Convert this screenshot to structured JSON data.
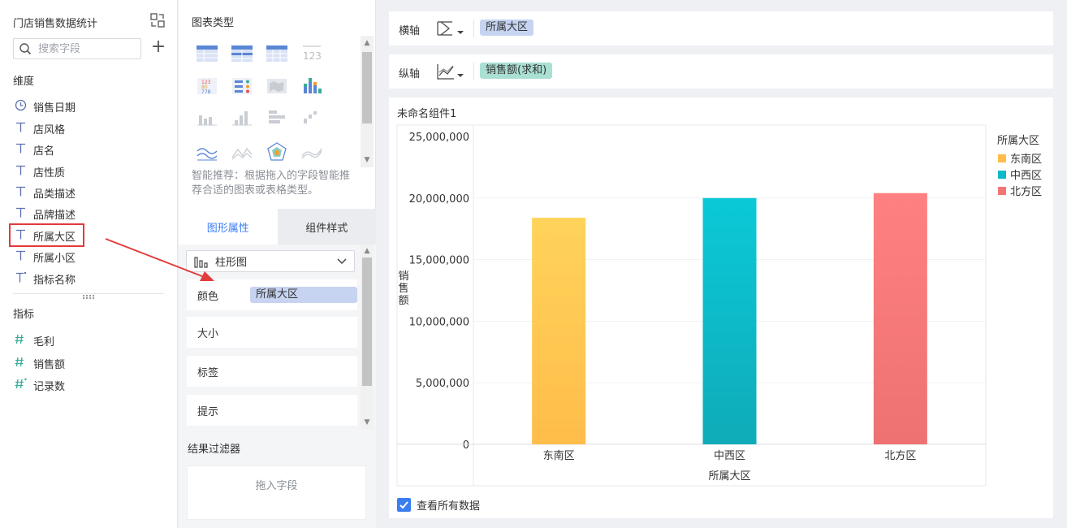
{
  "left": {
    "title": "门店销售数据统计",
    "search_placeholder": "搜索字段",
    "dimension_label": "维度",
    "dimensions": [
      {
        "label": "销售日期",
        "icon": "clock-icon"
      },
      {
        "label": "店风格",
        "icon": "text-type-icon"
      },
      {
        "label": "店名",
        "icon": "text-type-icon"
      },
      {
        "label": "店性质",
        "icon": "text-type-icon"
      },
      {
        "label": "品类描述",
        "icon": "text-type-icon"
      },
      {
        "label": "品牌描述",
        "icon": "text-type-icon"
      },
      {
        "label": "所属大区",
        "icon": "text-type-icon"
      },
      {
        "label": "所属小区",
        "icon": "text-type-icon"
      },
      {
        "label": "指标名称",
        "icon": "text-calc-icon"
      }
    ],
    "measure_label": "指标",
    "measures": [
      {
        "label": "毛利",
        "icon": "number-icon"
      },
      {
        "label": "销售额",
        "icon": "number-icon"
      },
      {
        "label": "记录数",
        "icon": "number-calc-icon"
      }
    ]
  },
  "mid": {
    "chart_type_title": "图表类型",
    "hint": "智能推荐：根据拖入的字段智能推荐合适的图表或表格类型。",
    "tabs": [
      {
        "label": "图形属性"
      },
      {
        "label": "组件样式"
      }
    ],
    "chart_type_selected": "柱形图",
    "props": {
      "color_label": "颜色",
      "color_field": "所属大区",
      "size_label": "大小",
      "label_label": "标签",
      "tooltip_label": "提示"
    },
    "filter_title": "结果过滤器",
    "filter_drop": "拖入字段"
  },
  "right": {
    "x_axis_label": "横轴",
    "x_axis_field": "所属大区",
    "y_axis_label": "纵轴",
    "y_axis_field": "销售额(求和)",
    "view_all": "查看所有数据"
  },
  "colors": {
    "accent": "#3c7df0",
    "bar1_top": "#ffd35a",
    "bar1_bottom": "#ffbd4a",
    "bar2_top": "#0bc9d8",
    "bar2_bottom": "#0fabb8",
    "bar3_top": "#ff8080",
    "bar3_bottom": "#ee7272"
  },
  "chart_data": {
    "type": "bar",
    "title": "未命名组件1",
    "categories": [
      "东南区",
      "中西区",
      "北方区"
    ],
    "values": [
      18400000,
      20000000,
      20400000
    ],
    "xlabel": "所属大区",
    "ylabel": "销售额",
    "ylim": [
      0,
      25000000
    ],
    "yticks": [
      "25,000,000",
      "20,000,000",
      "15,000,000",
      "10,000,000",
      "5,000,000",
      "0"
    ],
    "legend_title": "所属大区",
    "legend": [
      "东南区",
      "中西区",
      "北方区"
    ],
    "legend_colors": [
      "#ffbd4a",
      "#0fb8c6",
      "#f27676"
    ],
    "legend_position": "right",
    "grid": true
  }
}
